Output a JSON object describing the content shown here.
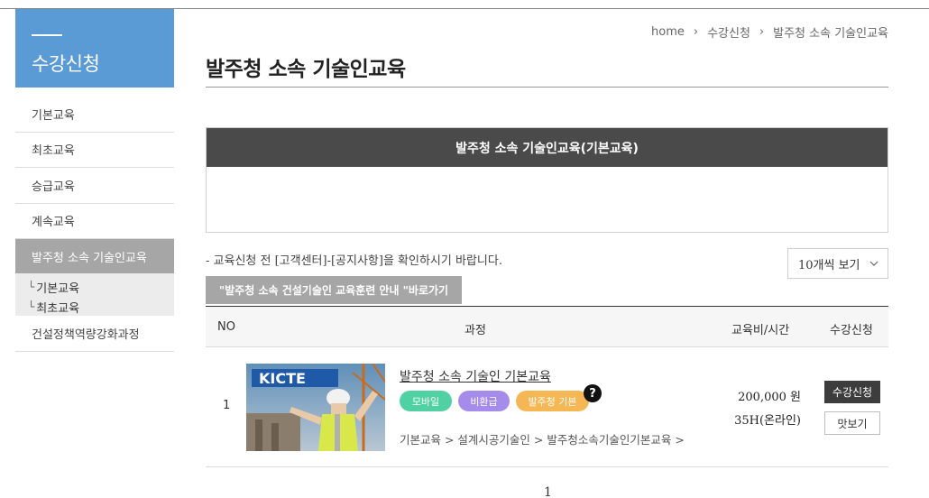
{
  "sidebar": {
    "title": "수강신청",
    "items": [
      {
        "label": "기본교육"
      },
      {
        "label": "최초교육"
      },
      {
        "label": "승급교육"
      },
      {
        "label": "계속교육"
      },
      {
        "label": "발주청 소속 기술인교육"
      }
    ],
    "sub_items": [
      {
        "label": "기본교육"
      },
      {
        "label": "최초교육"
      }
    ],
    "last_item": "건설정책역량강화과정"
  },
  "breadcrumb": {
    "home": "home",
    "level1": "수강신청",
    "level2": "발주청 소속 기술인교육"
  },
  "page": {
    "title": "발주청 소속 기술인교육",
    "notice_title": "발주청 소속 기술인교육(기본교육)",
    "notice_body": "",
    "info_text": "- 교육신청 전 [고객센터]-[공지사항]을 확인하시기 바랍니다.",
    "guide_button": "\"발주청 소속 건설기술인 교육훈련 안내 \"바로가기",
    "view_select": "10개씩 보기"
  },
  "table": {
    "headers": {
      "no": "NO",
      "course": "과정",
      "fee_time": "교육비/시간",
      "apply": "수강신청"
    },
    "rows": [
      {
        "no": "1",
        "thumb_text": "KICTE",
        "title": "발주청 소속 기술인 기본교육",
        "badges": {
          "mobile": "모바일",
          "nonrefund": "비환급",
          "basic": "발주청 기본"
        },
        "help": "?",
        "path": "기본교육 > 설계시공기술인 > 발주청소속기술인기본교육 >",
        "fee": "200,000 원",
        "hours": "35H(온라인)",
        "apply_label": "수강신청",
        "preview_label": "맛보기"
      }
    ]
  },
  "pagination": {
    "current": "1"
  },
  "colors": {
    "sidebar_head": "#5b9bd5",
    "notice_head": "#4a4a4a",
    "badge_mobile": "#4fd1a3",
    "badge_nonrefund": "#a58bea",
    "badge_basic": "#f5b754"
  }
}
